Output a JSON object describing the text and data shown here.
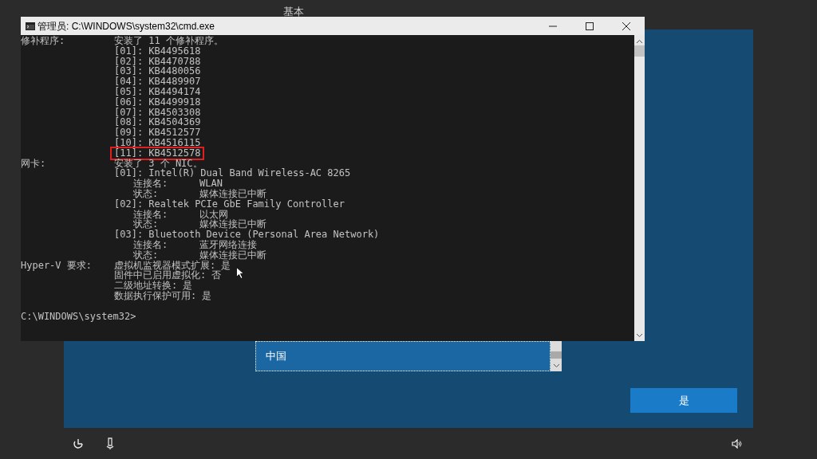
{
  "background_heading": "基本",
  "console": {
    "title": "管理员: C:\\WINDOWS\\system32\\cmd.exe",
    "lines": [
      {
        "kind": "field",
        "label": "修补程序:",
        "value": "安装了 11 个修补程序。",
        "highlighted": false
      },
      {
        "kind": "item",
        "value": "[01]: KB4495618",
        "highlighted": false
      },
      {
        "kind": "item",
        "value": "[02]: KB4470788",
        "highlighted": false
      },
      {
        "kind": "item",
        "value": "[03]: KB4480056",
        "highlighted": false
      },
      {
        "kind": "item",
        "value": "[04]: KB4489907",
        "highlighted": false
      },
      {
        "kind": "item",
        "value": "[05]: KB4494174",
        "highlighted": false
      },
      {
        "kind": "item",
        "value": "[06]: KB4499918",
        "highlighted": false
      },
      {
        "kind": "item",
        "value": "[07]: KB4503308",
        "highlighted": false
      },
      {
        "kind": "item",
        "value": "[08]: KB4504369",
        "highlighted": false
      },
      {
        "kind": "item",
        "value": "[09]: KB4512577",
        "highlighted": false
      },
      {
        "kind": "item",
        "value": "[10]: KB4516115",
        "highlighted": false
      },
      {
        "kind": "item",
        "value": "[11]: KB4512578",
        "highlighted": true
      },
      {
        "kind": "field",
        "label": "网卡:",
        "value": "安装了 3 个 NIC。",
        "highlighted": false
      },
      {
        "kind": "item",
        "value": "[01]: Intel(R) Dual Band Wireless-AC 8265",
        "highlighted": false
      },
      {
        "kind": "sub",
        "label": "连接名:",
        "value": "WLAN",
        "highlighted": false
      },
      {
        "kind": "sub",
        "label": "状态:",
        "value": "媒体连接已中断",
        "highlighted": false
      },
      {
        "kind": "item",
        "value": "[02]: Realtek PCIe GbE Family Controller",
        "highlighted": false
      },
      {
        "kind": "sub",
        "label": "连接名:",
        "value": "以太网",
        "highlighted": false
      },
      {
        "kind": "sub",
        "label": "状态:",
        "value": "媒体连接已中断",
        "highlighted": false
      },
      {
        "kind": "item",
        "value": "[03]: Bluetooth Device (Personal Area Network)",
        "highlighted": false
      },
      {
        "kind": "sub",
        "label": "连接名:",
        "value": "蓝牙网络连接",
        "highlighted": false
      },
      {
        "kind": "sub",
        "label": "状态:",
        "value": "媒体连接已中断",
        "highlighted": false
      },
      {
        "kind": "field",
        "label": "Hyper-V 要求:",
        "value": "虚拟机监视器模式扩展: 是",
        "highlighted": false
      },
      {
        "kind": "item",
        "value": "固件中已启用虚拟化: 否",
        "highlighted": false
      },
      {
        "kind": "item",
        "value": "二级地址转换: 是",
        "highlighted": false
      },
      {
        "kind": "item",
        "value": "数据执行保护可用: 是",
        "highlighted": false
      },
      {
        "kind": "blank",
        "highlighted": false
      },
      {
        "kind": "prompt",
        "value": "C:\\WINDOWS\\system32>",
        "highlighted": false
      }
    ]
  },
  "region_list": {
    "items": [
      {
        "label": "中国",
        "selected": true
      }
    ]
  },
  "button": "是"
}
